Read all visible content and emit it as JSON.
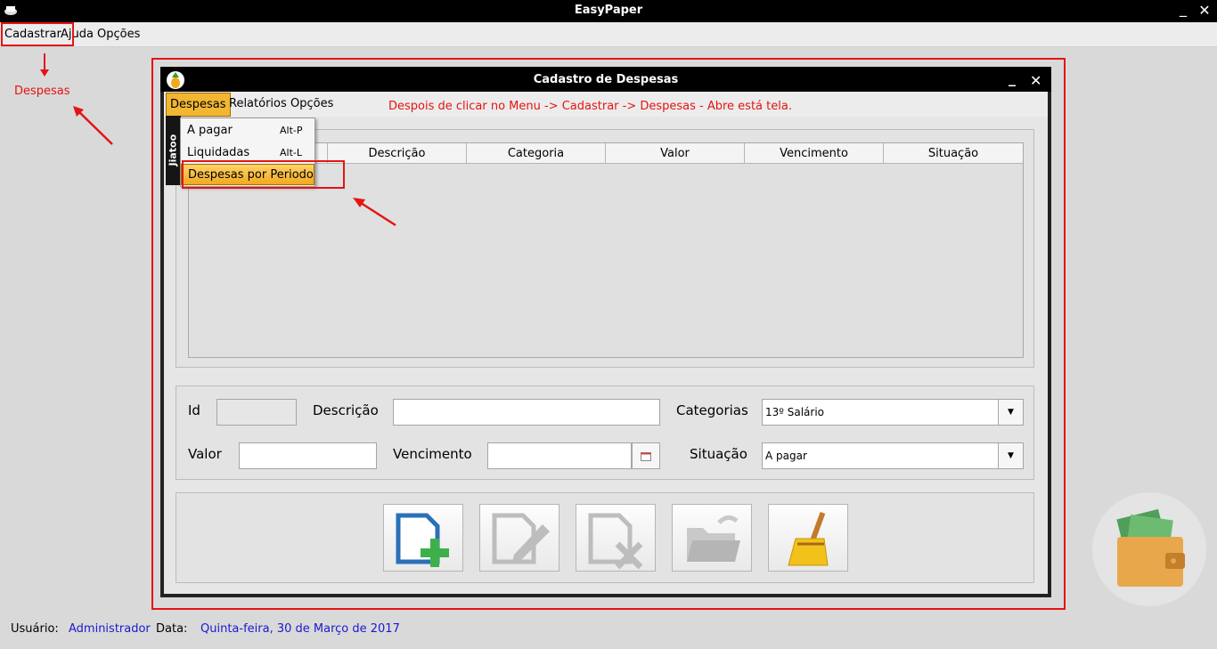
{
  "app": {
    "title": "EasyPaper",
    "minimize": "_",
    "close": "✕"
  },
  "main_menu": {
    "items": [
      "Cadastrar",
      "Ajuda",
      "Opções"
    ]
  },
  "annotations": {
    "despesas_label": "Despesas",
    "instruction": "Despois de clicar no Menu -> Cadastrar -> Despesas - Abre está tela."
  },
  "internal_frame": {
    "title": "Cadastro de Despesas",
    "minimize": "_",
    "close": "✕",
    "menu": {
      "items": [
        "Despesas",
        "Relatórios",
        "Opções"
      ]
    },
    "dropdown": {
      "side_label": "Jiatoo",
      "items": [
        {
          "label": "A pagar",
          "accel": "Alt-P"
        },
        {
          "label": "Liquidadas",
          "accel": "Alt-L"
        },
        {
          "label": "Despesas por Periodo",
          "accel": ""
        }
      ]
    },
    "table": {
      "columns": [
        "",
        "Descrição",
        "Categoria",
        "Valor",
        "Vencimento",
        "Situação"
      ]
    },
    "form": {
      "id_label": "Id",
      "id_value": "",
      "descricao_label": "Descrição",
      "descricao_value": "",
      "categorias_label": "Categorias",
      "categorias_value": "13º Salário",
      "valor_label": "Valor",
      "valor_value": "",
      "vencimento_label": "Vencimento",
      "vencimento_value": "",
      "situacao_label": "Situação",
      "situacao_value": "A pagar"
    },
    "buttons": [
      {
        "name": "add-button",
        "icon": "document-add-icon"
      },
      {
        "name": "edit-button",
        "icon": "document-edit-icon"
      },
      {
        "name": "delete-button",
        "icon": "document-delete-icon"
      },
      {
        "name": "open-button",
        "icon": "folder-open-icon"
      },
      {
        "name": "clear-button",
        "icon": "broom-icon"
      }
    ]
  },
  "statusbar": {
    "user_label": "Usuário:",
    "user_value": "Administrador",
    "date_label": "Data:",
    "date_value": "Quinta-feira, 30 de Março de 2017"
  },
  "colors": {
    "annotation_red": "#e41414",
    "status_blue": "#1a1acd",
    "menu_highlight": "#f2b632"
  }
}
